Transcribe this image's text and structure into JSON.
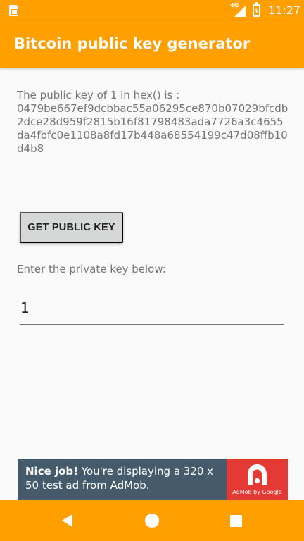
{
  "status_bar": {
    "time": "11:27",
    "network": "4G",
    "icons": [
      "sim-card-icon",
      "signal-icon",
      "battery-charging-icon"
    ]
  },
  "app_bar": {
    "title": "Bitcoin public key generator"
  },
  "result": {
    "prefix": "The public key of 1 in hex() is :",
    "public_key": "0479be667ef9dcbbac55a06295ce870b07029bfcdb2dce28d959f2815b16f81798483ada7726a3c4655da4fbfc0e1108a8fd17b448a68554199c47d08ffb10d4b8"
  },
  "actions": {
    "get_public_key_label": "GET PUBLIC KEY"
  },
  "form": {
    "prompt": "Enter the private key below:",
    "private_key_value": "1"
  },
  "ad": {
    "headline": "Nice job!",
    "body": " You're displaying a 320 x 50 test ad from AdMob.",
    "caption": "AdMob by Google"
  },
  "nav_bar": {
    "icons": [
      "back-icon",
      "home-icon",
      "recents-icon"
    ]
  },
  "colors": {
    "primary": "#ff9f00",
    "ad_background": "#455b6b",
    "admob_red": "#e53935",
    "button": "#d6d7d7"
  }
}
